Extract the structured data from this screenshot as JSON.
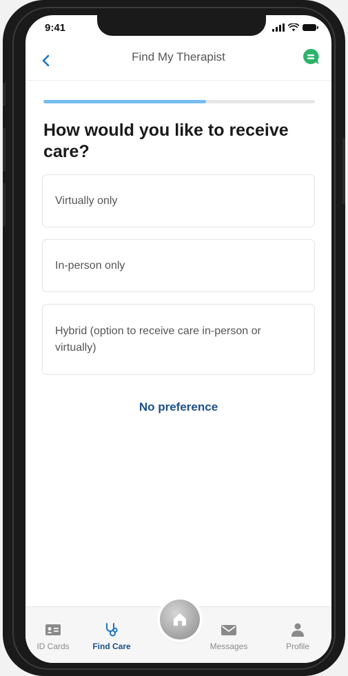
{
  "status_bar": {
    "time": "9:41"
  },
  "header": {
    "title": "Find My Therapist",
    "back_icon": "chevron-left-icon",
    "chat_icon": "chat-bubble-icon",
    "accent_color": "#1a73c9",
    "chat_color": "#2db36b"
  },
  "progress": {
    "fraction": 0.6
  },
  "question": "How would you like to receive care?",
  "options": [
    {
      "label": "Virtually only"
    },
    {
      "label": "In-person only"
    },
    {
      "label": "Hybrid (option to receive care in-person or virtually)"
    }
  ],
  "no_preference_label": "No preference",
  "tabbar": {
    "tabs": [
      {
        "label": "ID Cards",
        "icon": "id-card-icon",
        "active": false
      },
      {
        "label": "Find Care",
        "icon": "stethoscope-icon",
        "active": true
      },
      {
        "label": "Home",
        "icon": "home-icon",
        "active": false
      },
      {
        "label": "Messages",
        "icon": "envelope-icon",
        "active": false
      },
      {
        "label": "Profile",
        "icon": "person-icon",
        "active": false
      }
    ],
    "active_color": "#1b4f87"
  }
}
